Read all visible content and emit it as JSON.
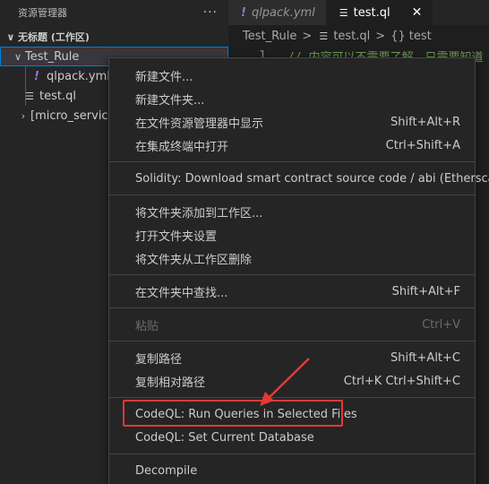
{
  "sidebar": {
    "title": "资源管理器",
    "more_icon": "ellipsis-icon",
    "workspace": "无标题 (工作区)",
    "folder": "Test_Rule",
    "files": [
      "qlpack.yml",
      "test.ql"
    ],
    "other_folder": "[micro_service_"
  },
  "tabs": [
    {
      "label": "qlpack.yml",
      "icon": "yml-exclamation-icon",
      "active": false
    },
    {
      "label": "test.ql",
      "icon": "ql-file-icon",
      "active": true,
      "close": "✕"
    }
  ],
  "breadcrumb": {
    "folder": "Test_Rule",
    "file": "test.ql",
    "symbol_icon": "{}",
    "symbol": "test"
  },
  "code": {
    "line": "1",
    "text": "// 内容可以不需要了解，只需要知道"
  },
  "menu": {
    "items": [
      {
        "label": "新建文件...",
        "shortcut": ""
      },
      {
        "label": "新建文件夹...",
        "shortcut": ""
      },
      {
        "label": "在文件资源管理器中显示",
        "shortcut": "Shift+Alt+R"
      },
      {
        "label": "在集成终端中打开",
        "shortcut": "Ctrl+Shift+A"
      },
      {
        "label": "Solidity: Download smart contract source code / abi (Etherscan)",
        "shortcut": ""
      },
      {
        "label": "将文件夹添加到工作区...",
        "shortcut": ""
      },
      {
        "label": "打开文件夹设置",
        "shortcut": ""
      },
      {
        "label": "将文件夹从工作区删除",
        "shortcut": ""
      },
      {
        "label": "在文件夹中查找...",
        "shortcut": "Shift+Alt+F"
      },
      {
        "label": "粘贴",
        "shortcut": "Ctrl+V"
      },
      {
        "label": "复制路径",
        "shortcut": "Shift+Alt+C"
      },
      {
        "label": "复制相对路径",
        "shortcut": "Ctrl+K Ctrl+Shift+C"
      },
      {
        "label": "CodeQL: Run Queries in Selected Files",
        "shortcut": ""
      },
      {
        "label": "CodeQL: Set Current Database",
        "shortcut": ""
      },
      {
        "label": "Decompile",
        "shortcut": ""
      }
    ]
  },
  "annotation": {
    "color": "#e53935"
  }
}
